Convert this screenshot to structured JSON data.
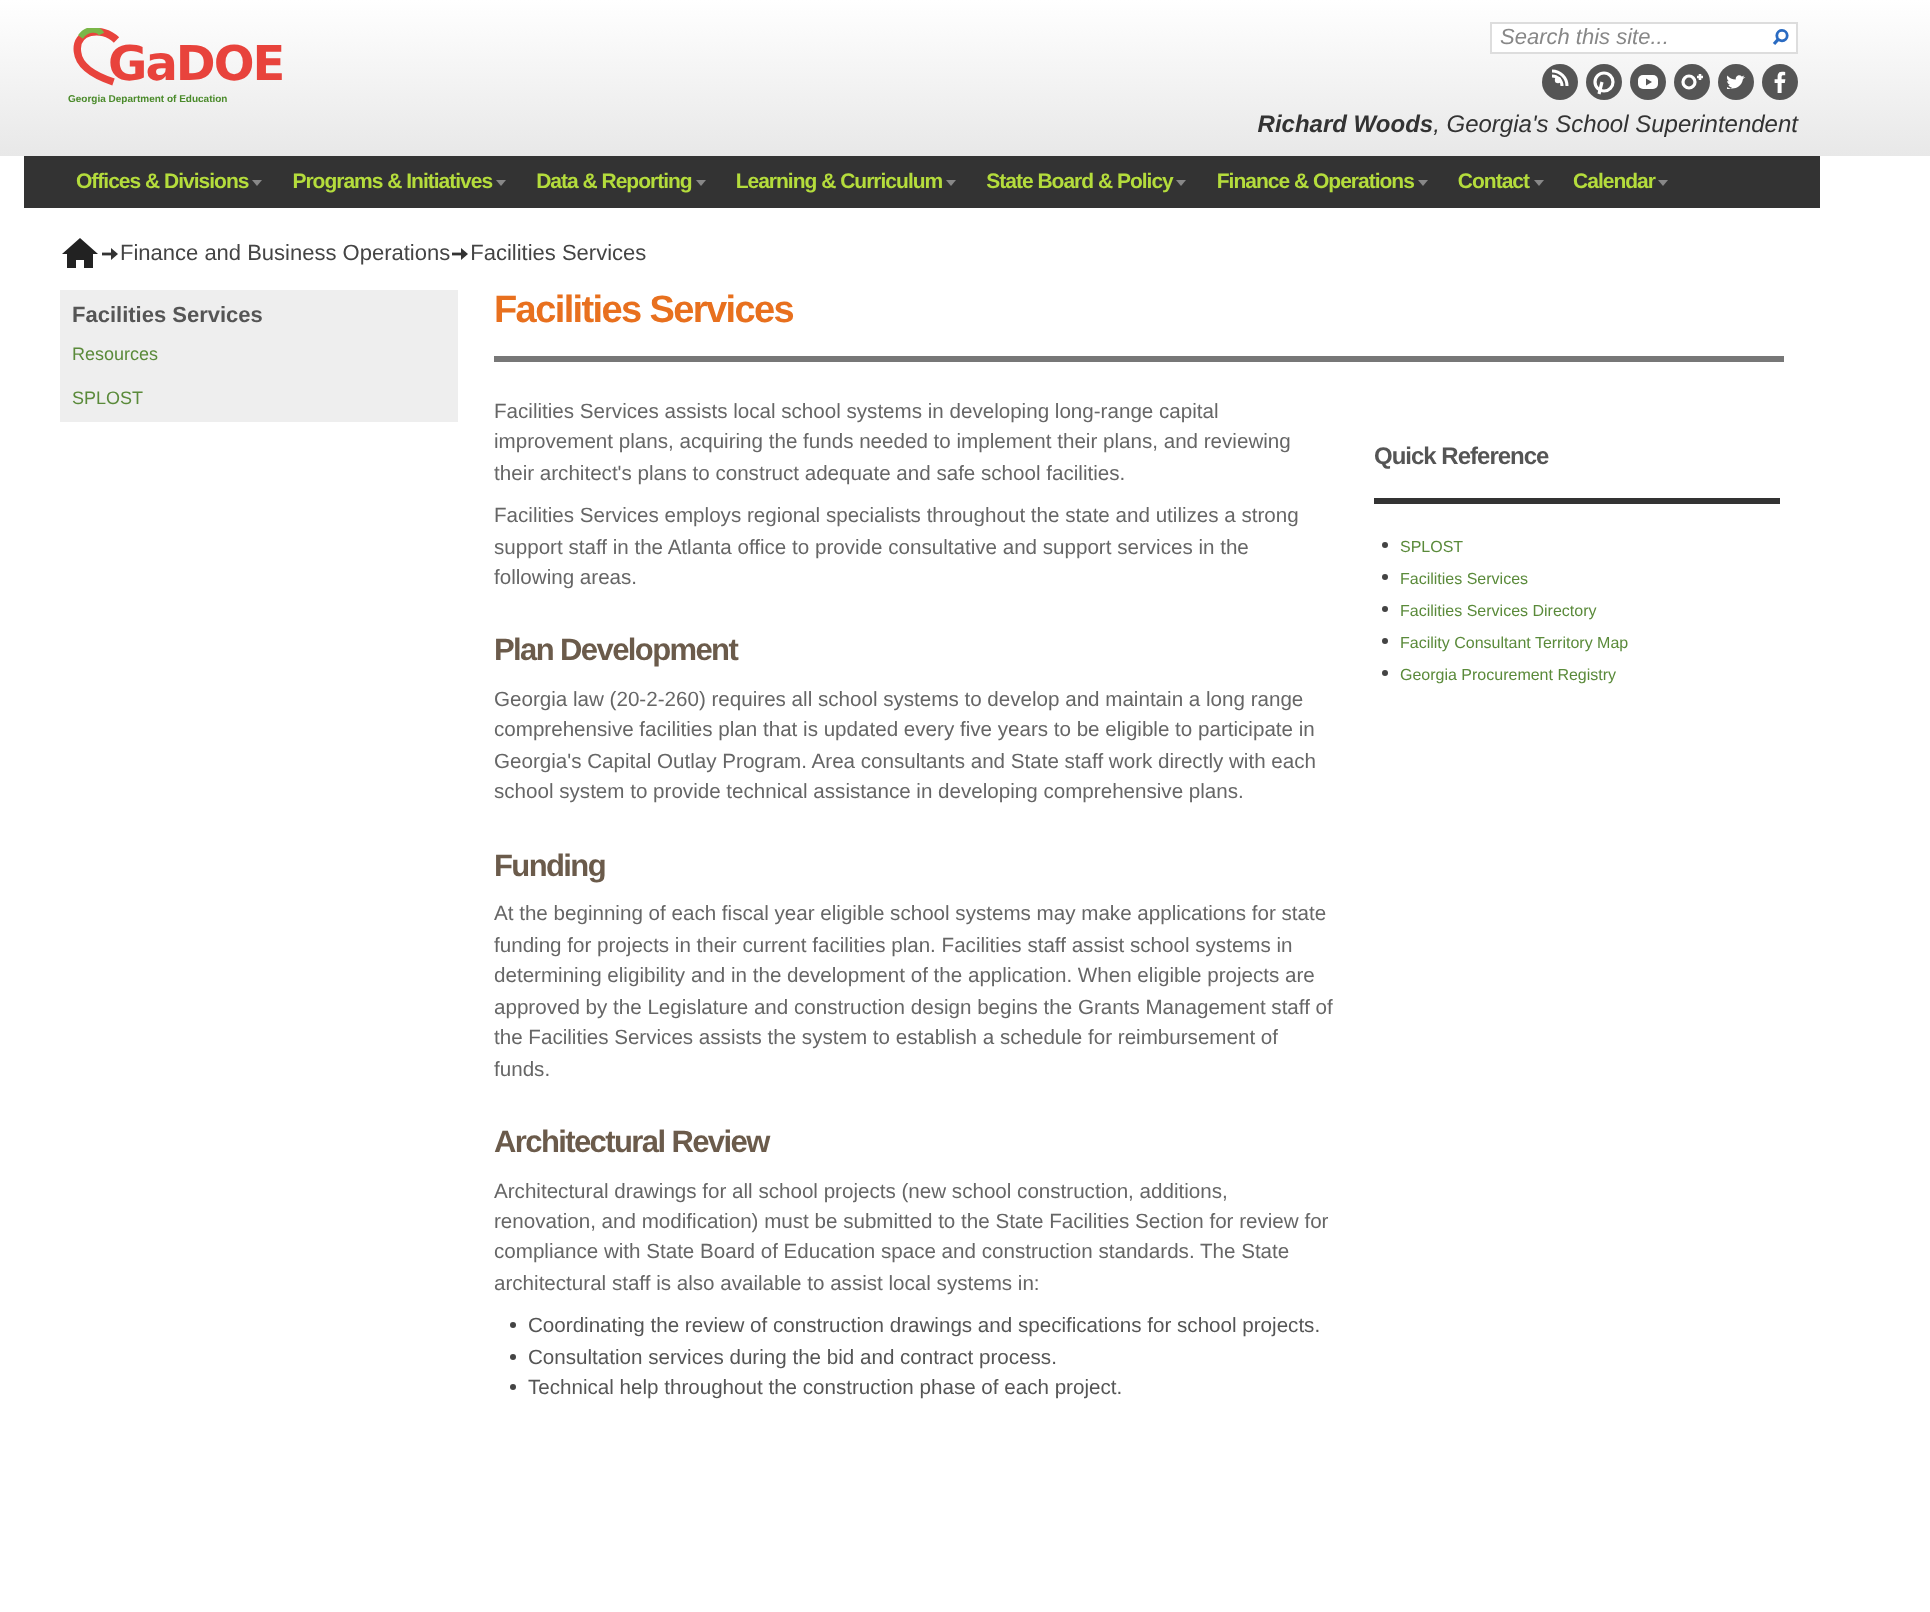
{
  "header": {
    "logo_text": "GaDOE",
    "logo_subtitle": "Georgia Department of Education",
    "search": {
      "placeholder": "Search this site..."
    },
    "social": [
      {
        "kind": "rss"
      },
      {
        "kind": "pinterest"
      },
      {
        "kind": "youtube"
      },
      {
        "kind": "googleplus"
      },
      {
        "kind": "twitter"
      },
      {
        "kind": "facebook"
      }
    ],
    "tagline": "**Richard Woods**, Georgia's School Superintendent"
  },
  "nav": [
    {
      "label": "Offices & Divisions"
    },
    {
      "label": "Programs & Initiatives"
    },
    {
      "label": "Data & Reporting"
    },
    {
      "label": "Learning & Curriculum"
    },
    {
      "label": "State Board & Policy"
    },
    {
      "label": "Finance & Operations"
    },
    {
      "label": "Contact"
    },
    {
      "label": "Calendar"
    }
  ],
  "breadcrumb": [
    "Finance and Business Operations",
    "Facilities Services"
  ],
  "sidebar": {
    "title": "Facilities Services",
    "items": [
      "Resources",
      "SPLOST"
    ]
  },
  "main": {
    "title": "Facilities Services",
    "blocks": [
      {
        "kind": "paragraph",
        "text": "Facilities Services assists local school systems in developing long-range capital improvement plans, acquiring the funds needed to implement their plans, and reviewing their architect's plans to construct adequate and safe school facilities."
      },
      {
        "kind": "paragraph",
        "text": "Facilities Services employs regional specialists throughout the state and utilizes a strong support staff in the Atlanta office to provide consultative and support services in the following areas."
      },
      {
        "kind": "heading",
        "text": "Plan Development"
      },
      {
        "kind": "paragraph",
        "text": "Georgia law (20-2-260) requires all school systems to develop and maintain a long range comprehensive facilities plan that is updated every five years to be eligible to participate in Georgia's Capital Outlay Program. Area consultants and State staff work directly with each school system to provide technical assistance in developing comprehensive plans."
      },
      {
        "kind": "heading",
        "text": "Funding"
      },
      {
        "kind": "paragraph",
        "text": "At the beginning of each fiscal year eligible school systems may make applications for state funding for projects in their current facilities plan. Facilities staff assist school systems in determining eligibility and in the development of the application. When eligible projects are approved by the Legislature and construction design begins the Grants Management staff of the Facilities Services assists the system to establish a schedule for reimbursement of funds."
      },
      {
        "kind": "heading",
        "text": "Architectural Review"
      },
      {
        "kind": "paragraph",
        "text": "Architectural drawings for all school projects (new school construction, additions, renovation, and modification) must be submitted to the State Facilities Section for review for compliance with State Board of Education space and construction standards. The State architectural staff is also available to assist local systems in:"
      },
      {
        "kind": "list",
        "items": [
          "Coordinating the review of construction drawings and specifications for school projects.",
          "Consultation services during the bid and contract process.",
          "Technical help throughout the construction phase of each project."
        ]
      }
    ]
  },
  "quick_reference": {
    "title": "Quick Reference",
    "links": [
      "SPLOST",
      "Facilities Services",
      "Facilities Services Directory",
      "Facility Consultant Territory Map",
      "Georgia Procurement Registry"
    ]
  }
}
